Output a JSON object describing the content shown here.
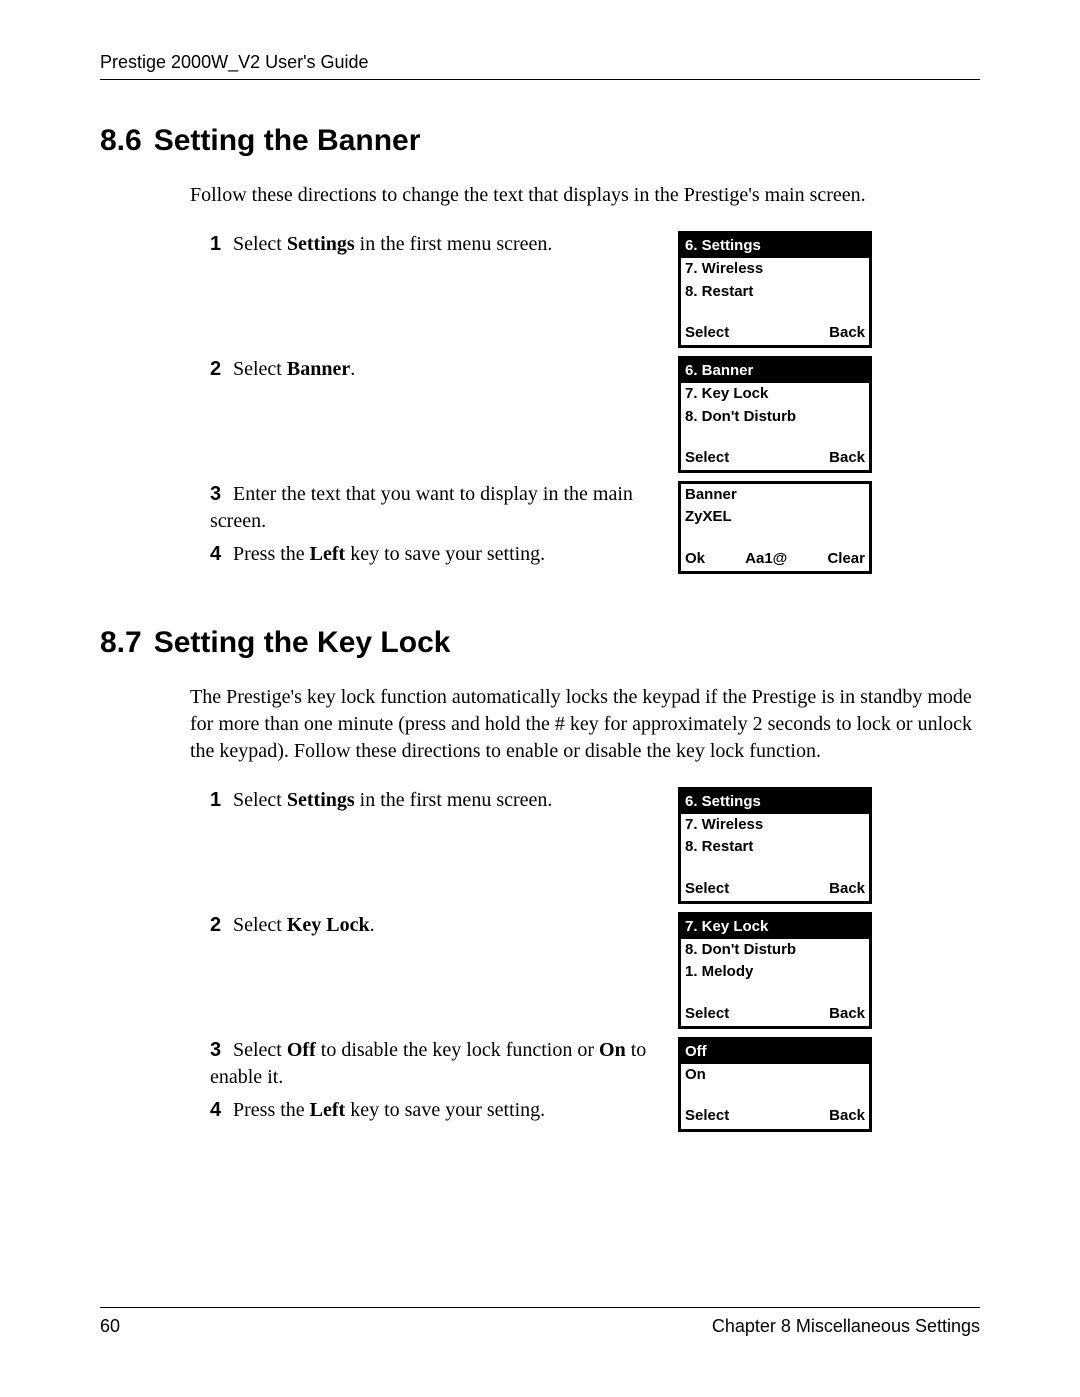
{
  "header": {
    "title": "Prestige 2000W_V2 User's Guide"
  },
  "footer": {
    "page": "60",
    "chapter": "Chapter 8 Miscellaneous Settings"
  },
  "s86": {
    "number": "8.6",
    "title": "Setting the Banner",
    "intro": "Follow these directions to change the text that displays in the Prestige's main screen.",
    "step1": {
      "n": "1",
      "a": "Select ",
      "b": "Settings",
      "c": " in the first menu screen."
    },
    "step2": {
      "n": "2",
      "a": "Select ",
      "b": "Banner",
      "c": "."
    },
    "step3": {
      "n": "3",
      "a": "Enter the text that you want to display in the main screen."
    },
    "step4": {
      "n": "4",
      "a": "Press the ",
      "b": "Left",
      "c": " key to save your setting."
    },
    "screen1": {
      "hl": "6. Settings",
      "l1": "7. Wireless",
      "l2": "8. Restart",
      "skL": "Select",
      "skR": "Back"
    },
    "screen2": {
      "hl": "6. Banner",
      "l1": "7. Key Lock",
      "l2": "8. Don't Disturb",
      "skL": "Select",
      "skR": "Back"
    },
    "screen3": {
      "l1": "Banner",
      "l2": "ZyXEL",
      "skL": "Ok",
      "skM": "Aa1@",
      "skR": "Clear"
    }
  },
  "s87": {
    "number": "8.7",
    "title": "Setting the Key Lock",
    "intro": "The Prestige's key lock function automatically locks the keypad if the Prestige is in standby mode for more than one minute (press and hold the # key for approximately 2 seconds to lock or unlock the keypad).  Follow these directions to enable or disable the key lock function.",
    "step1": {
      "n": "1",
      "a": "Select ",
      "b": "Settings",
      "c": " in the first menu screen."
    },
    "step2": {
      "n": "2",
      "a": "Select ",
      "b": "Key Lock",
      "c": "."
    },
    "step3": {
      "n": "3",
      "a": "Select ",
      "b": "Off",
      "c": " to disable the key lock function or ",
      "d": "On",
      "e": " to enable it."
    },
    "step4": {
      "n": "4",
      "a": "Press the ",
      "b": "Left",
      "c": " key to save your setting."
    },
    "screen1": {
      "hl": "6. Settings",
      "l1": "7. Wireless",
      "l2": "8. Restart",
      "skL": "Select",
      "skR": "Back"
    },
    "screen2": {
      "hl": "7. Key Lock",
      "l1": "8. Don't Disturb",
      "l2": "1. Melody",
      "skL": "Select",
      "skR": "Back"
    },
    "screen3": {
      "hl": "Off",
      "l1": "On",
      "skL": "Select",
      "skR": "Back"
    }
  }
}
